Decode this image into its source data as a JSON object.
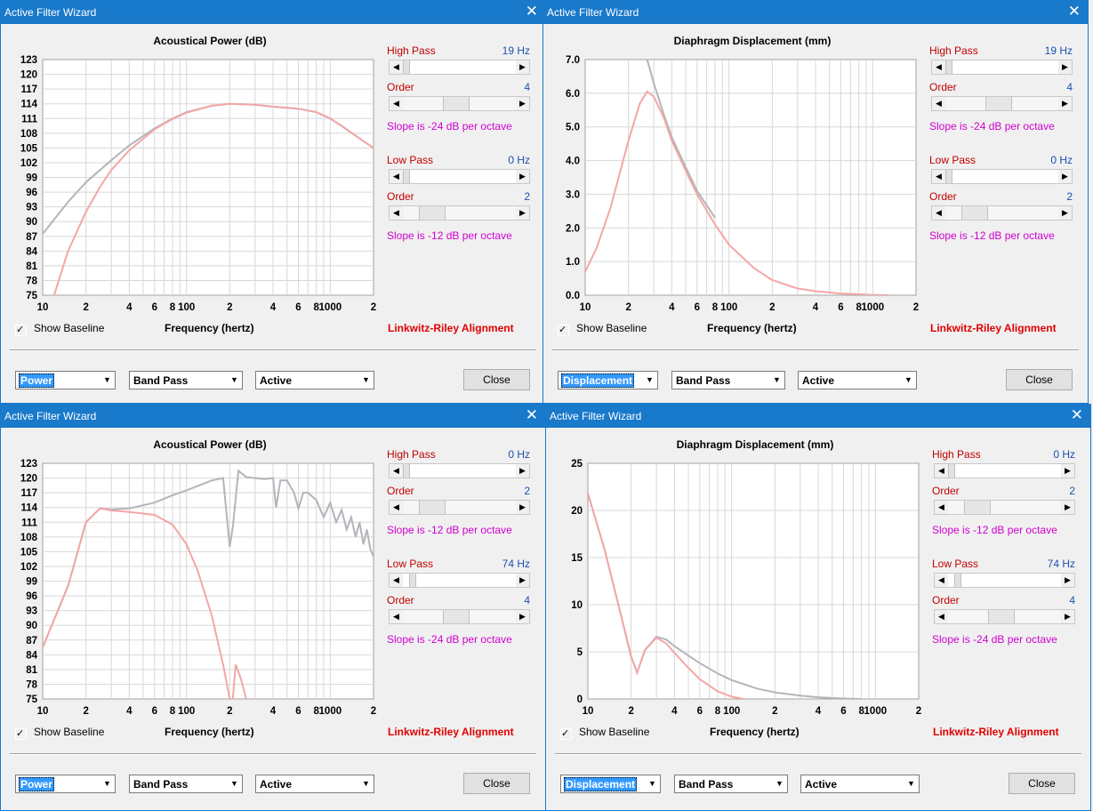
{
  "windows": [
    {
      "id": "w1",
      "title": "Active Filter Wizard",
      "chart_title": "Acoustical Power (dB)",
      "high_pass": {
        "label": "High Pass",
        "value": "19 Hz",
        "fraction": 0.0
      },
      "high_pass_order": {
        "label": "Order",
        "value": "4",
        "fraction": 0.45
      },
      "high_pass_slope": "Slope is -24 dB per octave",
      "low_pass": {
        "label": "Low Pass",
        "value": "0 Hz",
        "fraction": 0.0
      },
      "low_pass_order": {
        "label": "Order",
        "value": "2",
        "fraction": 0.18
      },
      "low_pass_slope": "Slope is -12 dB per octave",
      "show_baseline": {
        "label": "Show Baseline",
        "checked": true,
        "check_glyph": "✓"
      },
      "freq_label": "Frequency (hertz)",
      "alignment": "Linkwitz-Riley Alignment",
      "combo1": "Power",
      "combo2": "Band Pass",
      "combo3": "Active",
      "close": "Close"
    },
    {
      "id": "w2",
      "title": "Active Filter Wizard",
      "chart_title": "Diaphragm Displacement (mm)",
      "high_pass": {
        "label": "High Pass",
        "value": "19 Hz",
        "fraction": 0.0
      },
      "high_pass_order": {
        "label": "Order",
        "value": "4",
        "fraction": 0.45
      },
      "high_pass_slope": "Slope is -24 dB per octave",
      "low_pass": {
        "label": "Low Pass",
        "value": "0 Hz",
        "fraction": 0.0
      },
      "low_pass_order": {
        "label": "Order",
        "value": "2",
        "fraction": 0.18
      },
      "low_pass_slope": "Slope is -12 dB per octave",
      "show_baseline": {
        "label": "Show Baseline",
        "checked": true,
        "check_glyph": "✓"
      },
      "freq_label": "Frequency (hertz)",
      "alignment": "Linkwitz-Riley Alignment",
      "combo1": "Displacement",
      "combo2": "Band Pass",
      "combo3": "Active",
      "close": "Close"
    },
    {
      "id": "w3",
      "title": "Active Filter Wizard",
      "chart_title": "Acoustical Power (dB)",
      "high_pass": {
        "label": "High Pass",
        "value": "0 Hz",
        "fraction": 0.0
      },
      "high_pass_order": {
        "label": "Order",
        "value": "2",
        "fraction": 0.18
      },
      "high_pass_slope": "Slope is -12 dB per octave",
      "low_pass": {
        "label": "Low Pass",
        "value": "74 Hz",
        "fraction": 0.06
      },
      "low_pass_order": {
        "label": "Order",
        "value": "4",
        "fraction": 0.45
      },
      "low_pass_slope": "Slope is -24 dB per octave",
      "show_baseline": {
        "label": "Show Baseline",
        "checked": true,
        "check_glyph": "✓"
      },
      "freq_label": "Frequency (hertz)",
      "alignment": "Linkwitz-Riley Alignment",
      "combo1": "Power",
      "combo2": "Band Pass",
      "combo3": "Active",
      "close": "Close"
    },
    {
      "id": "w4",
      "title": "Active Filter Wizard",
      "chart_title": "Diaphragm Displacement (mm)",
      "high_pass": {
        "label": "High Pass",
        "value": "0 Hz",
        "fraction": 0.0
      },
      "high_pass_order": {
        "label": "Order",
        "value": "2",
        "fraction": 0.18
      },
      "high_pass_slope": "Slope is -12 dB per octave",
      "low_pass": {
        "label": "Low Pass",
        "value": "74 Hz",
        "fraction": 0.06
      },
      "low_pass_order": {
        "label": "Order",
        "value": "4",
        "fraction": 0.45
      },
      "low_pass_slope": "Slope is -24 dB per octave",
      "show_baseline": {
        "label": "Show Baseline",
        "checked": true,
        "check_glyph": "✓"
      },
      "freq_label": "Frequency (hertz)",
      "alignment": "Linkwitz-Riley Alignment",
      "combo1": "Displacement",
      "combo2": "Band Pass",
      "combo3": "Active",
      "close": "Close"
    }
  ],
  "colors": {
    "titlebar": "#1979ca",
    "filtered_curve": "#f4a6a6",
    "baseline_curve": "#b4b4bc",
    "grid": "#d8d8d8"
  },
  "chart_data": [
    {
      "type": "line",
      "window": "w1",
      "title": "Acoustical Power (dB)",
      "xlabel": "Frequency (hertz)",
      "ylabel": "",
      "xscale": "log",
      "xlim": [
        10,
        2000
      ],
      "ylim": [
        75,
        123
      ],
      "x_tick_labels": [
        "10",
        "2",
        "4",
        "6",
        "8",
        "100",
        "2",
        "4",
        "6",
        "8",
        "1000",
        "2"
      ],
      "x_tick_values": [
        10,
        20,
        40,
        60,
        80,
        100,
        200,
        400,
        600,
        800,
        1000,
        2000
      ],
      "y_tick_labels": [
        "123",
        "120",
        "117",
        "114",
        "111",
        "108",
        "105",
        "102",
        "99",
        "96",
        "93",
        "90",
        "87",
        "84",
        "81",
        "78",
        "75"
      ],
      "grid": true,
      "series": [
        {
          "name": "baseline",
          "color_key": "baseline_curve",
          "x": [
            10,
            15,
            20,
            30,
            40,
            60,
            80,
            100,
            150,
            200,
            300,
            400,
            600,
            800,
            1000,
            1200,
            1500,
            2000
          ],
          "y": [
            87.5,
            94,
            98,
            102.5,
            105.5,
            109,
            111,
            112.3,
            113.6,
            114,
            113.8,
            113.4,
            113,
            112.3,
            111,
            109.5,
            107.5,
            105
          ]
        },
        {
          "name": "filtered",
          "color_key": "filtered_curve",
          "x": [
            12,
            15,
            20,
            25,
            30,
            40,
            60,
            80,
            100,
            150,
            200,
            300,
            400,
            600,
            800,
            1000,
            1200,
            1500,
            2000
          ],
          "y": [
            75,
            84,
            92,
            97,
            100.5,
            104.5,
            108.8,
            110.9,
            112.2,
            113.6,
            114,
            113.8,
            113.4,
            113,
            112.3,
            111,
            109.5,
            107.5,
            105
          ]
        }
      ]
    },
    {
      "type": "line",
      "window": "w2",
      "title": "Diaphragm Displacement (mm)",
      "xlabel": "Frequency (hertz)",
      "xscale": "log",
      "xlim": [
        10,
        2000
      ],
      "ylim": [
        0,
        7
      ],
      "x_tick_labels": [
        "10",
        "2",
        "4",
        "6",
        "8",
        "100",
        "2",
        "4",
        "6",
        "8",
        "1000",
        "2"
      ],
      "x_tick_values": [
        10,
        20,
        40,
        60,
        80,
        100,
        200,
        400,
        600,
        800,
        1000,
        2000
      ],
      "y_tick_labels": [
        "7.0",
        "6.0",
        "5.0",
        "4.0",
        "3.0",
        "2.0",
        "1.0",
        "0.0"
      ],
      "grid": true,
      "series": [
        {
          "name": "baseline",
          "color_key": "baseline_curve",
          "x": [
            27,
            30,
            35,
            40,
            50,
            60,
            80
          ],
          "y": [
            7.0,
            6.3,
            5.4,
            4.7,
            3.8,
            3.1,
            2.3
          ]
        },
        {
          "name": "filtered",
          "color_key": "filtered_curve",
          "x": [
            10,
            12,
            15,
            20,
            24,
            27,
            30,
            35,
            40,
            50,
            60,
            80,
            100,
            150,
            200,
            300,
            400,
            600,
            800,
            1000,
            1300
          ],
          "y": [
            0.7,
            1.4,
            2.6,
            4.6,
            5.7,
            6.05,
            5.9,
            5.3,
            4.6,
            3.7,
            3.0,
            2.1,
            1.5,
            0.8,
            0.45,
            0.2,
            0.12,
            0.05,
            0.03,
            0.01,
            0.0
          ]
        }
      ]
    },
    {
      "type": "line",
      "window": "w3",
      "title": "Acoustical Power (dB)",
      "xlabel": "Frequency (hertz)",
      "xscale": "log",
      "xlim": [
        10,
        2000
      ],
      "ylim": [
        75,
        123
      ],
      "x_tick_labels": [
        "10",
        "2",
        "4",
        "6",
        "8",
        "100",
        "2",
        "4",
        "6",
        "8",
        "1000",
        "2"
      ],
      "x_tick_values": [
        10,
        20,
        40,
        60,
        80,
        100,
        200,
        400,
        600,
        800,
        1000,
        2000
      ],
      "y_tick_labels": [
        "123",
        "120",
        "117",
        "114",
        "111",
        "108",
        "105",
        "102",
        "99",
        "96",
        "93",
        "90",
        "87",
        "84",
        "81",
        "78",
        "75"
      ],
      "grid": true,
      "series": [
        {
          "name": "baseline",
          "color_key": "baseline_curve",
          "x": [
            10,
            15,
            20,
            25,
            30,
            40,
            60,
            80,
            100,
            150,
            180,
            200,
            210,
            230,
            260,
            300,
            350,
            400,
            420,
            450,
            500,
            560,
            600,
            650,
            700,
            800,
            900,
            1000,
            1100,
            1200,
            1300,
            1400,
            1500,
            1600,
            1700,
            1800,
            1900,
            2000
          ],
          "y": [
            85.5,
            98,
            111,
            113.8,
            113.6,
            113.8,
            115,
            116.5,
            117.5,
            119.5,
            120,
            106,
            110,
            121.5,
            120.2,
            120,
            119.8,
            120,
            114,
            119.5,
            119.5,
            117,
            113.8,
            117,
            117,
            115.5,
            112,
            115,
            111,
            113.5,
            109.5,
            112,
            108,
            111,
            106.5,
            109.5,
            105.5,
            104
          ]
        },
        {
          "name": "filtered",
          "color_key": "filtered_curve",
          "x": [
            10,
            15,
            20,
            25,
            30,
            40,
            60,
            80,
            100,
            120,
            150,
            180,
            200,
            210,
            220,
            240,
            260
          ],
          "y": [
            85.5,
            98,
            111,
            113.8,
            113.4,
            113.1,
            112.5,
            110.5,
            106.5,
            101,
            92,
            82,
            75,
            75,
            82,
            79,
            75
          ]
        }
      ]
    },
    {
      "type": "line",
      "window": "w4",
      "title": "Diaphragm Displacement (mm)",
      "xlabel": "Frequency (hertz)",
      "xscale": "log",
      "xlim": [
        10,
        2000
      ],
      "ylim": [
        0,
        25
      ],
      "x_tick_labels": [
        "10",
        "2",
        "4",
        "6",
        "8",
        "100",
        "2",
        "4",
        "6",
        "8",
        "1000",
        "2"
      ],
      "x_tick_values": [
        10,
        20,
        40,
        60,
        80,
        100,
        200,
        400,
        600,
        800,
        1000,
        2000
      ],
      "y_tick_labels": [
        "25",
        "20",
        "15",
        "10",
        "5",
        "0"
      ],
      "grid": true,
      "series": [
        {
          "name": "baseline",
          "color_key": "baseline_curve",
          "x": [
            10,
            13,
            16,
            20,
            22,
            25,
            30,
            35,
            40,
            50,
            60,
            80,
            100,
            150,
            200,
            300,
            400,
            600,
            800
          ],
          "y": [
            21.8,
            16,
            10.5,
            4.5,
            2.8,
            5.2,
            6.6,
            6.3,
            5.6,
            4.6,
            3.8,
            2.7,
            2.0,
            1.1,
            0.7,
            0.35,
            0.18,
            0.05,
            0.0
          ]
        },
        {
          "name": "filtered",
          "color_key": "filtered_curve",
          "x": [
            10,
            13,
            16,
            20,
            22,
            25,
            30,
            35,
            40,
            50,
            60,
            80,
            100,
            120
          ],
          "y": [
            21.8,
            16,
            10.5,
            4.5,
            2.8,
            5.2,
            6.5,
            5.9,
            4.9,
            3.3,
            2.1,
            0.8,
            0.25,
            0.0
          ]
        }
      ]
    }
  ]
}
